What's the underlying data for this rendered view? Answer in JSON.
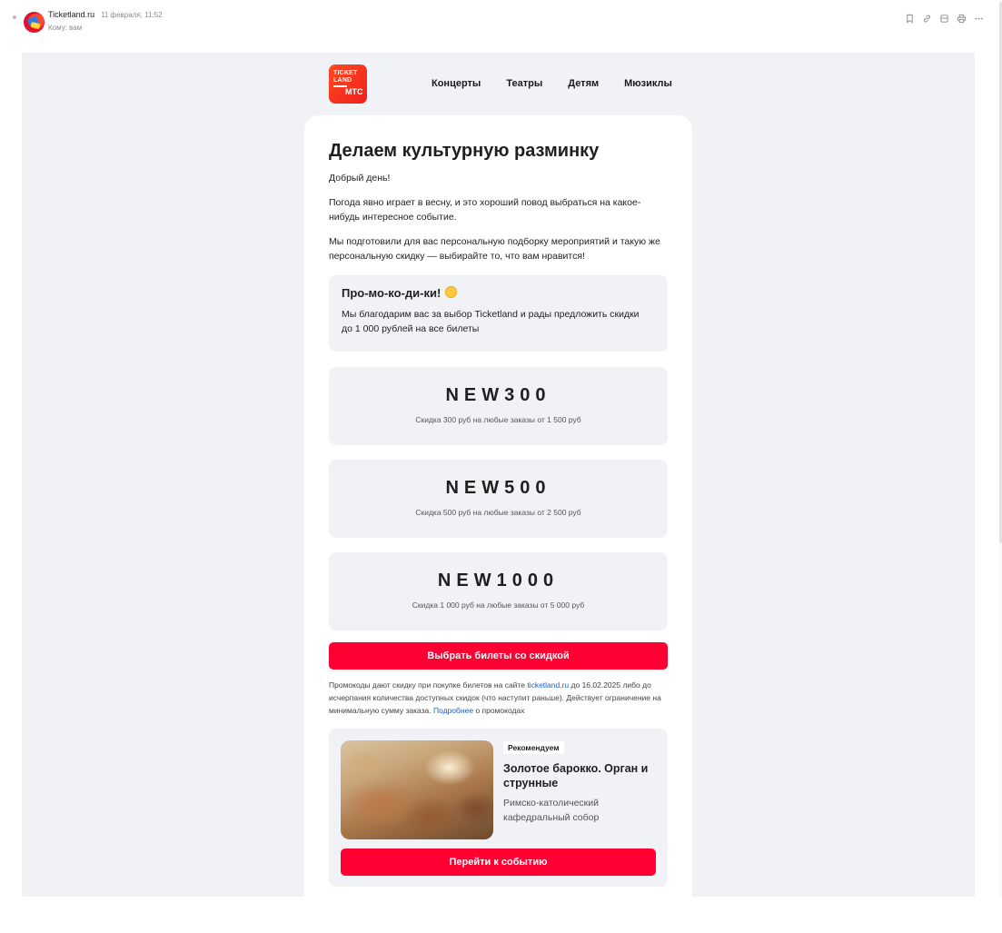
{
  "mail": {
    "sender": "Ticketland.ru",
    "date": "11 февраля, 11:52",
    "to": "Кому: вам",
    "toolbar_icons": [
      "bookmark-icon",
      "link-icon",
      "archive-icon",
      "print-icon",
      "more-icon"
    ]
  },
  "brand": {
    "logo_line1": "TICKET",
    "logo_line2": "LAND",
    "logo_line3": "МТС",
    "accent": "#ff0032",
    "logo_color": "#f0201e"
  },
  "nav": [
    "Концерты",
    "Театры",
    "Детям",
    "Мюзиклы"
  ],
  "content": {
    "title": "Делаем культурную разминку",
    "greeting": "Добрый день!",
    "para1": "Погода явно играет в весну, и это хороший повод выбраться на какое-нибудь интересное событие.",
    "para2": "Мы подготовили для вас персональную подборку мероприятий и такую же персональную скидку — выбирайте то, что вам нравится!"
  },
  "promo": {
    "title": "Про-мо-ко-ди-ки!",
    "text": "Мы благодарим вас за выбор Ticketland и рады предложить скидки до 1 000 рублей на все билеты"
  },
  "codes": [
    {
      "code": "NEW300",
      "desc": "Скидка 300 руб на любые заказы от 1 500 руб"
    },
    {
      "code": "NEW500",
      "desc": "Скидка 500 руб на любые заказы от 2 500 руб"
    },
    {
      "code": "NEW1000",
      "desc": "Скидка 1 000 руб на любые заказы от 5 000 руб"
    }
  ],
  "cta_discount": "Выбрать билеты со скидкой",
  "fine_print": {
    "part1": "Промокоды дают скидку при покупке билетов на сайте ",
    "link1": "ticketland.ru",
    "part2": " до 16.02.2025 либо до исчерпания количества доступных скидок (что наступит раньше). Действует ограничение на минимальную сумму заказа. ",
    "link2": "Подробнее",
    "part3": " о промокодах"
  },
  "event": {
    "badge": "Рекомендуем",
    "title": "Золотое барокко. Орган и струнные",
    "venue": "Римско-католический кафедральный собор",
    "cta": "Перейти к событию"
  }
}
